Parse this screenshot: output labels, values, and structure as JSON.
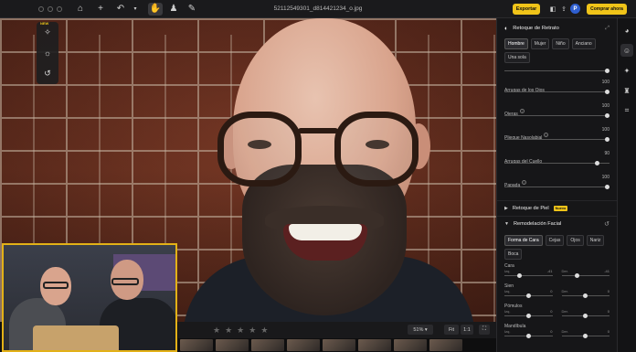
{
  "window": {
    "filename": "52112549301_d814421234_o.jpg",
    "export_label": "Exportar",
    "buy_label": "Comprar ahora",
    "avatar_initial": "P"
  },
  "tool_rail": {
    "new_badge": "NEW"
  },
  "bottom_bar": {
    "zoom": "51%",
    "fit_label": "Fit",
    "one_to_one": "1:1",
    "rating_stars": 5
  },
  "panel": {
    "title": "Retoque de Retrato",
    "subject_chips": [
      {
        "label": "Hombre",
        "selected": true
      },
      {
        "label": "Mujer",
        "selected": false
      },
      {
        "label": "Niño",
        "selected": false
      },
      {
        "label": "Anciano",
        "selected": false
      },
      {
        "label": "Una sola",
        "selected": false
      }
    ],
    "sliders": [
      {
        "label": "Arrugas de los Ojos",
        "value": "100",
        "level": 1.0
      },
      {
        "label": "Ojeras",
        "value": "100",
        "level": 1.0
      },
      {
        "label": "Pliegue Nasolabial",
        "value": "100",
        "level": 1.0
      },
      {
        "label": "Arrugas del Cuello",
        "value": "90",
        "level": 0.9
      },
      {
        "label": "Papada",
        "value": "100",
        "level": 1.0
      }
    ],
    "skin_section": {
      "label": "Retoque de Piel",
      "badge": "Nuevo"
    },
    "reshape_section": {
      "label": "Remodelación Facial"
    },
    "reshape_chips": [
      {
        "label": "Forma de Cara",
        "selected": true
      },
      {
        "label": "Cejas",
        "selected": false
      },
      {
        "label": "Ojos",
        "selected": false
      },
      {
        "label": "Nariz",
        "selected": false
      },
      {
        "label": "Boca",
        "selected": false
      }
    ],
    "face_groups": [
      {
        "label": "Cara",
        "left": {
          "sub": "Izq.",
          "value": "-41",
          "level": 0.3
        },
        "right": {
          "sub": "Der.",
          "value": "-41",
          "level": 0.3
        }
      },
      {
        "label": "Sien",
        "left": {
          "sub": "Izq.",
          "value": "0",
          "level": 0.5
        },
        "right": {
          "sub": "Der.",
          "value": "0",
          "level": 0.5
        }
      },
      {
        "label": "Pómulos",
        "left": {
          "sub": "Izq.",
          "value": "0",
          "level": 0.5
        },
        "right": {
          "sub": "Der.",
          "value": "0",
          "level": 0.5
        }
      },
      {
        "label": "Mandíbula",
        "left": {
          "sub": "Izq.",
          "value": "0",
          "level": 0.5
        },
        "right": {
          "sub": "Der.",
          "value": "0",
          "level": 0.5
        }
      }
    ]
  }
}
